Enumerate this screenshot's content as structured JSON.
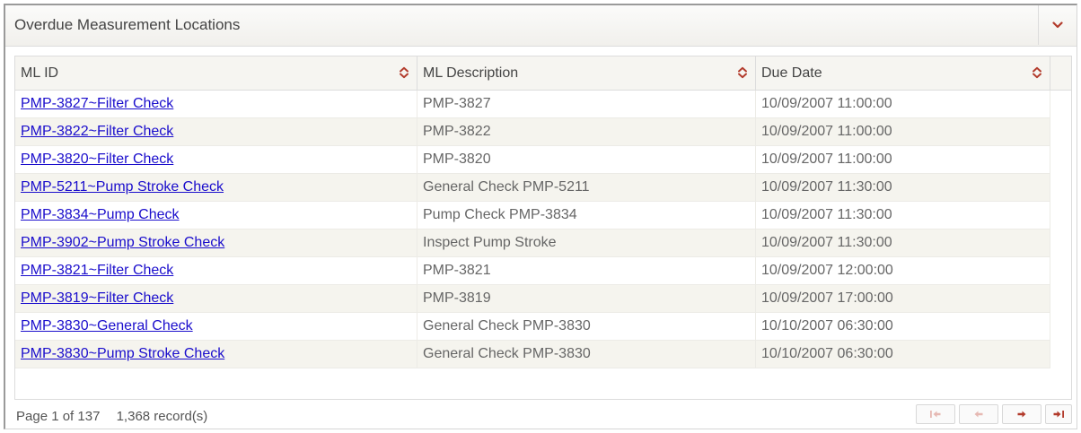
{
  "widget": {
    "title": "Overdue Measurement Locations"
  },
  "colors": {
    "accent": "#b23a2b",
    "disabled": "#e6b9b3",
    "link": "#1a0dcc"
  },
  "columns": [
    {
      "label": "ML ID",
      "sort_icon": "sort-icon"
    },
    {
      "label": "ML Description",
      "sort_icon": "sort-icon"
    },
    {
      "label": "Due Date",
      "sort_icon": "sort-icon"
    }
  ],
  "rows": [
    {
      "ml_id": "PMP-3827~Filter Check",
      "description": "PMP-3827",
      "due_date": "10/09/2007 11:00:00"
    },
    {
      "ml_id": "PMP-3822~Filter Check",
      "description": "PMP-3822",
      "due_date": "10/09/2007 11:00:00"
    },
    {
      "ml_id": "PMP-3820~Filter Check",
      "description": "PMP-3820",
      "due_date": "10/09/2007 11:00:00"
    },
    {
      "ml_id": "PMP-5211~Pump Stroke Check",
      "description": "General Check PMP-5211",
      "due_date": "10/09/2007 11:30:00"
    },
    {
      "ml_id": "PMP-3834~Pump Check",
      "description": "Pump Check PMP-3834",
      "due_date": "10/09/2007 11:30:00"
    },
    {
      "ml_id": "PMP-3902~Pump Stroke Check",
      "description": "Inspect Pump Stroke",
      "due_date": "10/09/2007 11:30:00"
    },
    {
      "ml_id": "PMP-3821~Filter Check",
      "description": "PMP-3821",
      "due_date": "10/09/2007 12:00:00"
    },
    {
      "ml_id": "PMP-3819~Filter Check",
      "description": "PMP-3819",
      "due_date": "10/09/2007 17:00:00"
    },
    {
      "ml_id": "PMP-3830~General Check",
      "description": "General Check PMP-3830",
      "due_date": "10/10/2007 06:30:00"
    },
    {
      "ml_id": "PMP-3830~Pump Stroke Check",
      "description": "General Check PMP-3830",
      "due_date": "10/10/2007 06:30:00"
    }
  ],
  "footer": {
    "page_text": "Page 1 of 137",
    "records_text": "1,368 record(s)"
  }
}
